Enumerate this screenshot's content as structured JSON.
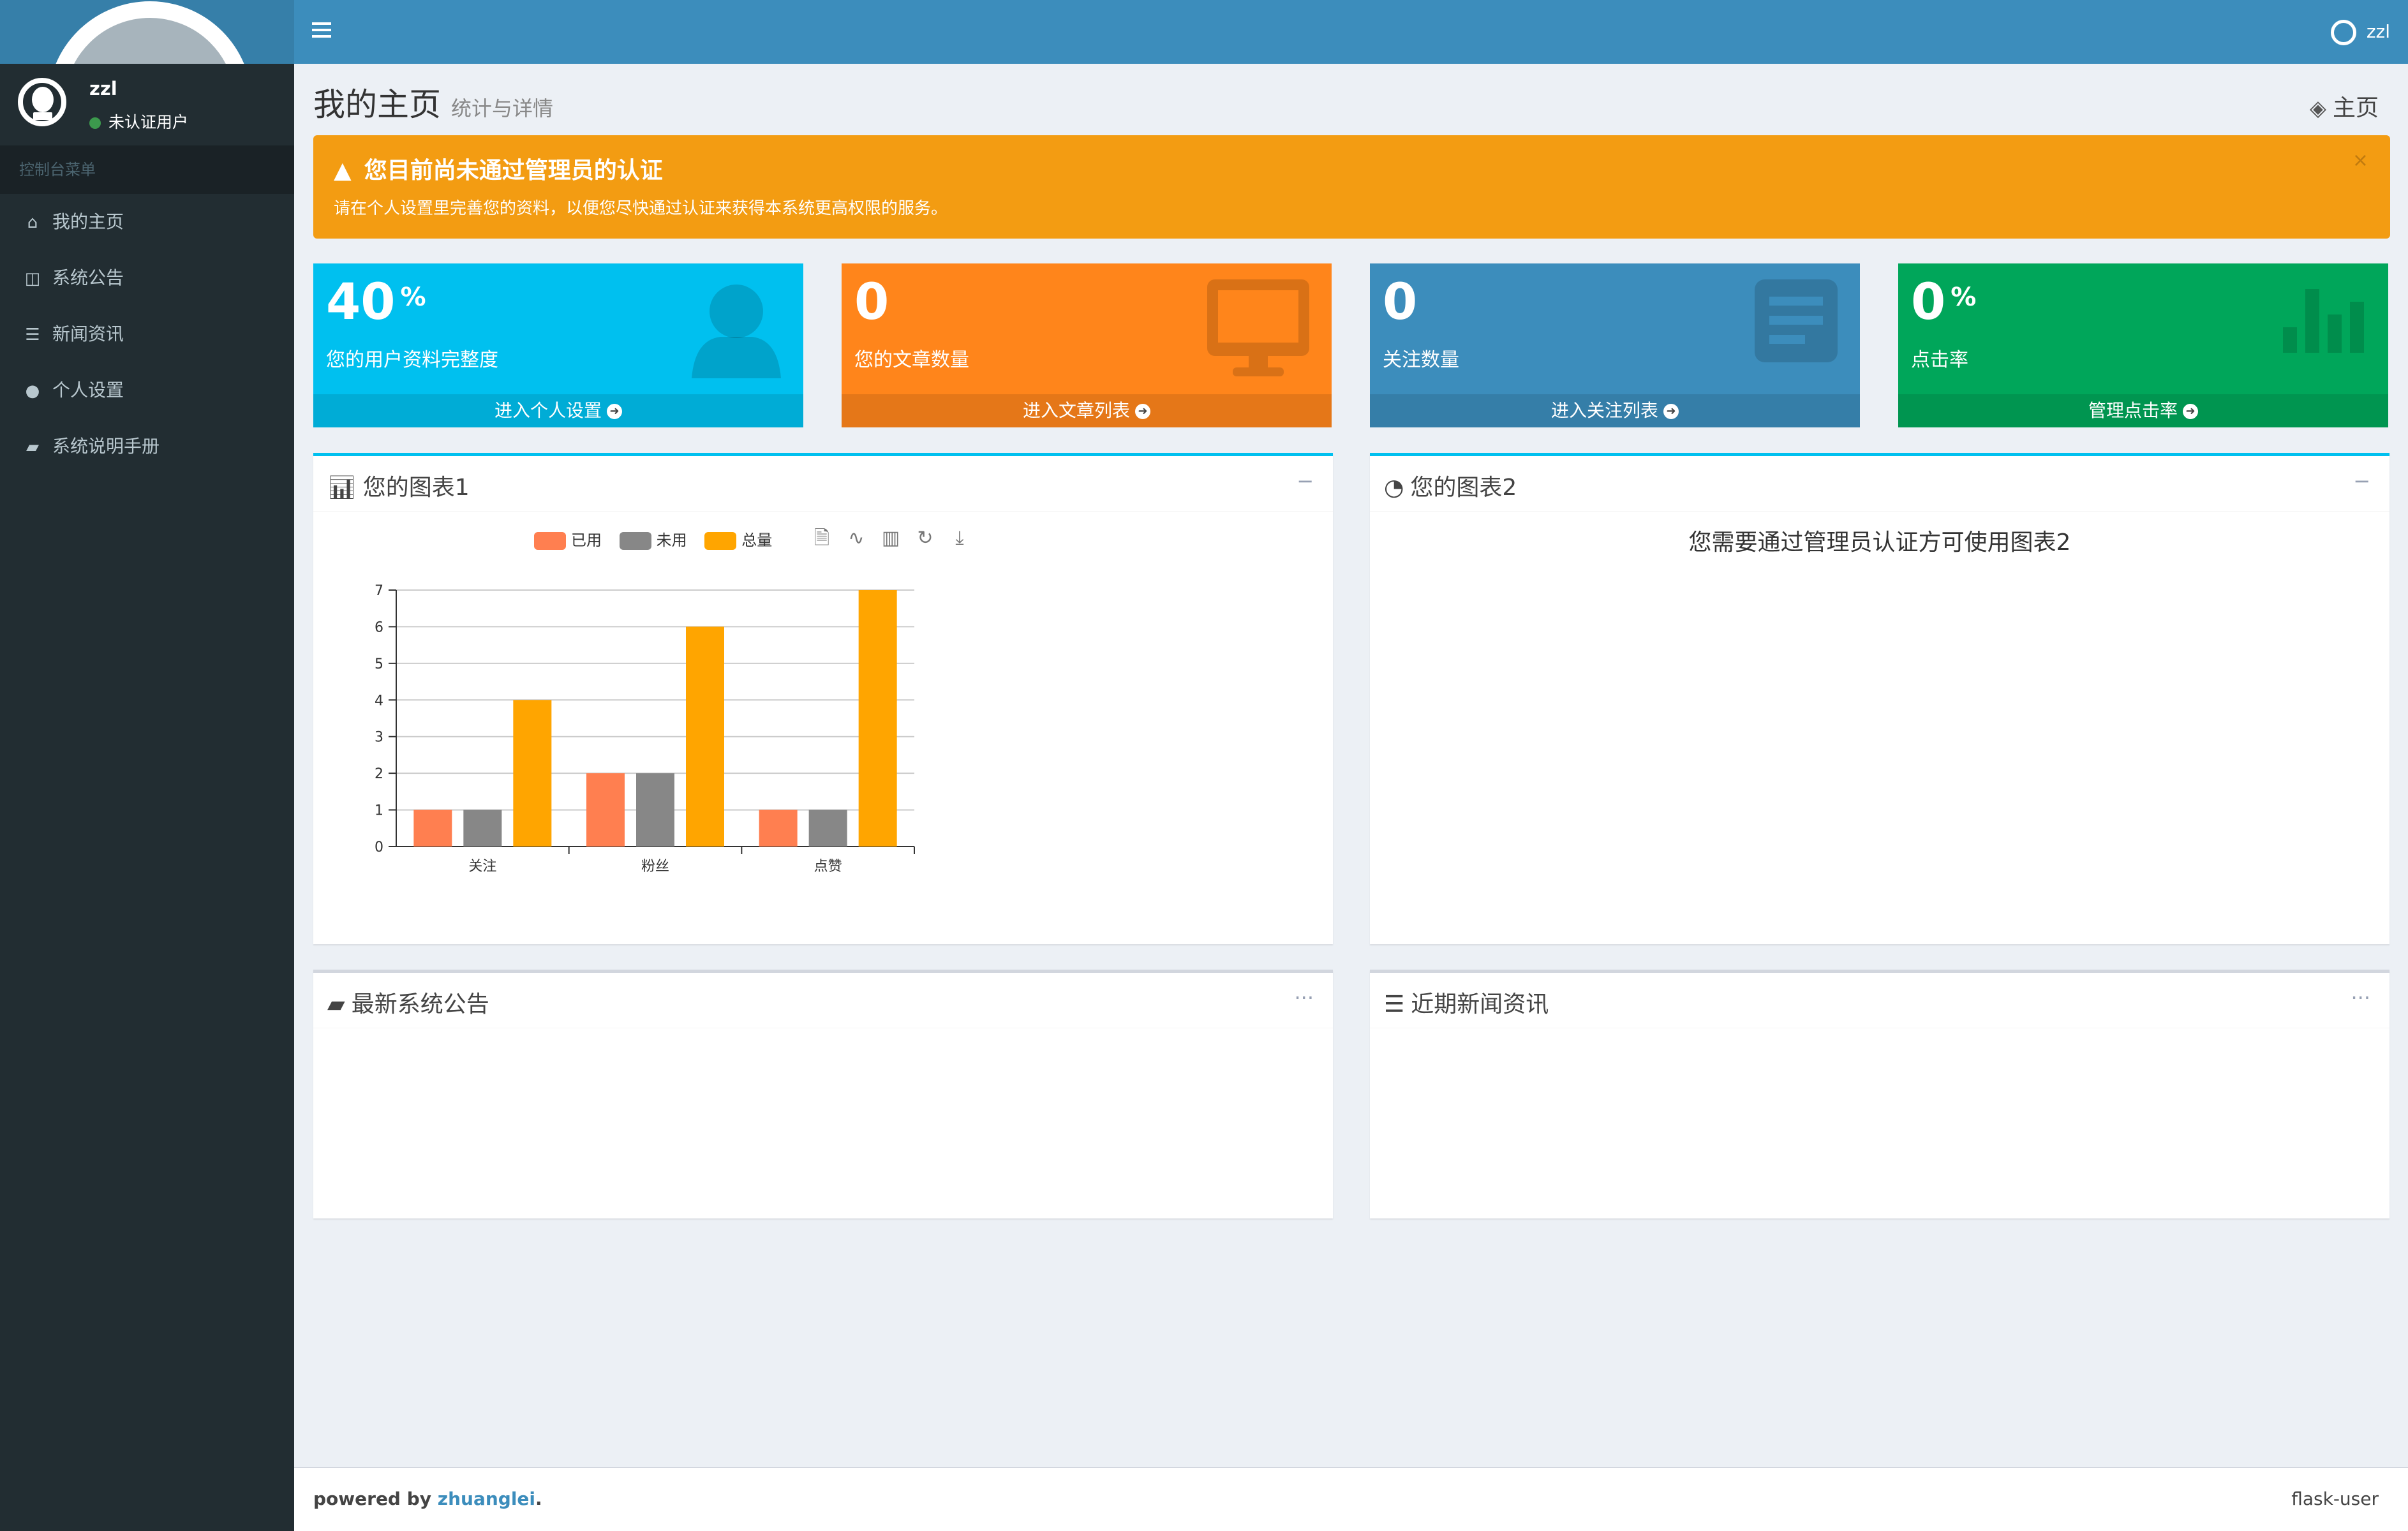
{
  "sidebar": {
    "user_name": "zzl",
    "user_status": "未认证用户",
    "menu_header": "控制台菜单",
    "items": [
      {
        "label": "我的主页",
        "icon": "home-icon"
      },
      {
        "label": "系统公告",
        "icon": "announcement-icon"
      },
      {
        "label": "新闻资讯",
        "icon": "news-icon"
      },
      {
        "label": "个人设置",
        "icon": "user-icon"
      },
      {
        "label": "系统说明手册",
        "icon": "book-icon"
      }
    ]
  },
  "header": {
    "user_name": "zzl"
  },
  "page": {
    "title": "我的主页",
    "subtitle": "统计与详情",
    "breadcrumb": "主页"
  },
  "alert": {
    "title": "您目前尚未通过管理员的认证",
    "message": "请在个人设置里完善您的资料，以便您尽快通过认证来获得本系统更高权限的服务。",
    "close": "×"
  },
  "stats": [
    {
      "value": "40",
      "unit": "%",
      "label": "您的用户资料完整度",
      "link": "进入个人设置",
      "color": "#00c0ef",
      "icon": "user-silhouette-icon"
    },
    {
      "value": "0",
      "unit": "",
      "label": "您的文章数量",
      "link": "进入文章列表",
      "color": "#ff851b",
      "icon": "monitor-icon"
    },
    {
      "value": "0",
      "unit": "",
      "label": "关注数量",
      "link": "进入关注列表",
      "color": "#3c8dbc",
      "icon": "list-icon"
    },
    {
      "value": "0",
      "unit": "%",
      "label": "点击率",
      "link": "管理点击率",
      "color": "#00a65a",
      "icon": "bar-chart-icon"
    }
  ],
  "chart1": {
    "title": "您的图表1",
    "tool": "−"
  },
  "chart2": {
    "title": "您的图表2",
    "tool": "−",
    "notice": "您需要通过管理员认证方可使用图表2"
  },
  "notices_box": {
    "title": "最新系统公告",
    "tool": "···"
  },
  "news_box": {
    "title": "近期新闻资讯",
    "tool": "···"
  },
  "footer": {
    "powered_prefix": "powered by",
    "author": "zhuanglei",
    "suffix": ".",
    "app_name": "flask-user"
  },
  "chart_data": {
    "type": "bar",
    "categories": [
      "关注",
      "粉丝",
      "点赞"
    ],
    "series": [
      {
        "name": "已用",
        "values": [
          1,
          2,
          1
        ],
        "color": "#ff7f50"
      },
      {
        "name": "未用",
        "values": [
          1,
          2,
          1
        ],
        "color": "#878787"
      },
      {
        "name": "总量",
        "values": [
          4,
          6,
          7
        ],
        "color": "#ffa500"
      }
    ],
    "ylim": [
      0,
      7
    ],
    "yticks": [
      0,
      1,
      2,
      3,
      4,
      5,
      6,
      7
    ],
    "grid": true,
    "legend_position": "top-center"
  }
}
